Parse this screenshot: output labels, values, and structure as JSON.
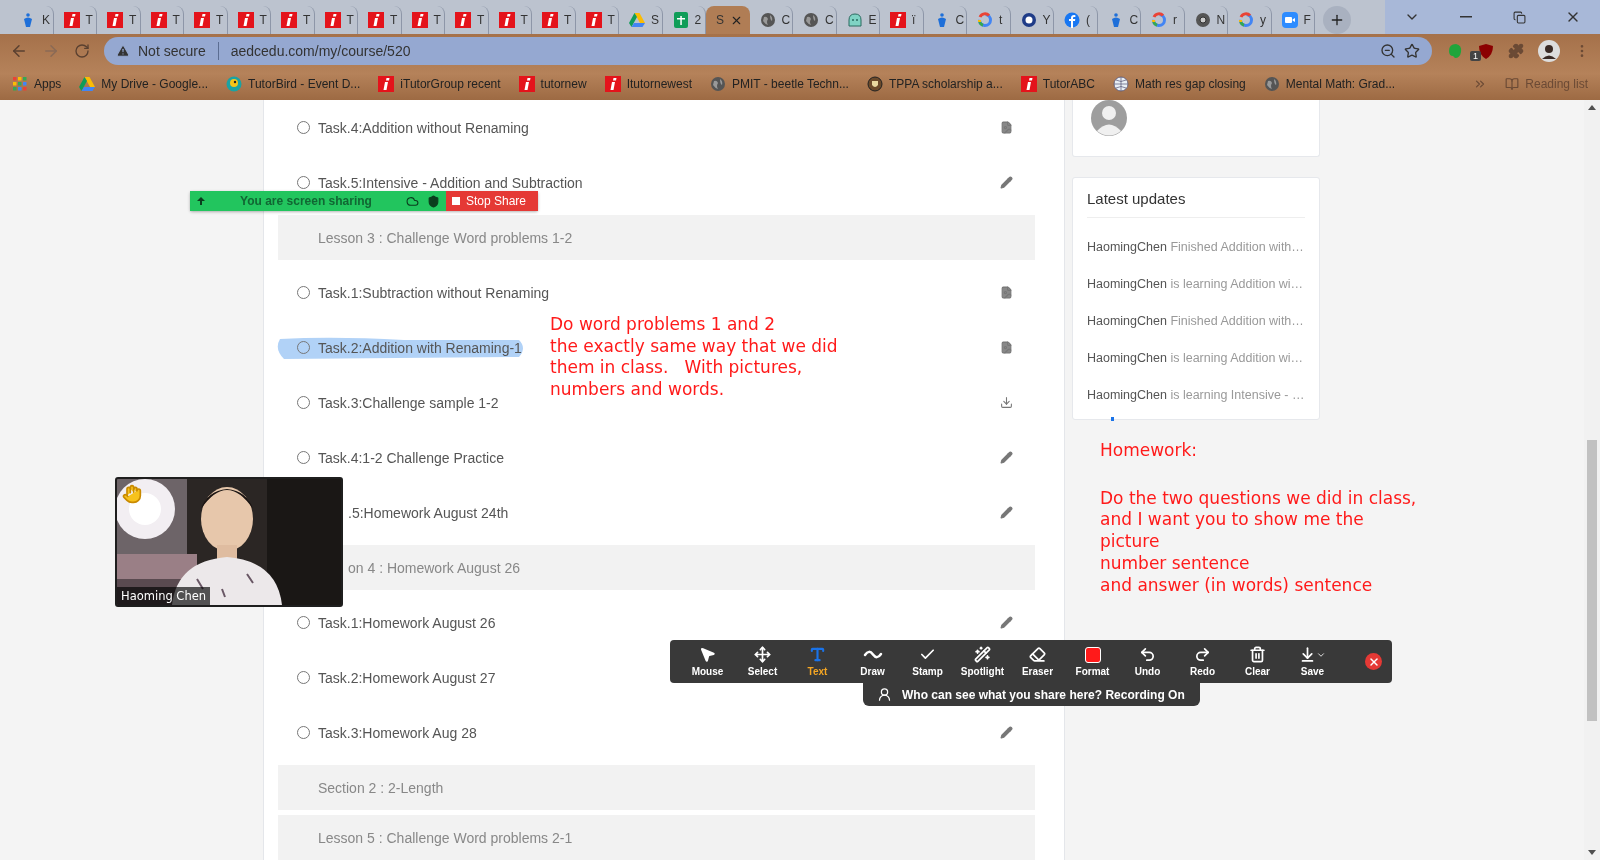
{
  "browser": {
    "tabs": [
      {
        "kind": "itutor",
        "title": "K",
        "selected": false
      },
      {
        "kind": "red-i",
        "title": "T",
        "selected": false
      },
      {
        "kind": "red-i",
        "title": "T",
        "selected": false
      },
      {
        "kind": "red-i",
        "title": "T",
        "selected": false
      },
      {
        "kind": "red-i",
        "title": "T",
        "selected": false
      },
      {
        "kind": "red-i",
        "title": "T",
        "selected": false
      },
      {
        "kind": "red-i",
        "title": "T",
        "selected": false
      },
      {
        "kind": "red-i",
        "title": "T",
        "selected": false
      },
      {
        "kind": "red-i",
        "title": "T",
        "selected": false
      },
      {
        "kind": "red-i",
        "title": "T",
        "selected": false
      },
      {
        "kind": "red-i",
        "title": "T",
        "selected": false
      },
      {
        "kind": "red-i",
        "title": "T",
        "selected": false
      },
      {
        "kind": "red-i",
        "title": "T",
        "selected": false
      },
      {
        "kind": "red-i",
        "title": "T",
        "selected": false
      },
      {
        "kind": "drive",
        "title": "S",
        "selected": false
      },
      {
        "kind": "sheets",
        "title": "2",
        "selected": false
      },
      {
        "kind": "none",
        "title": "S",
        "selected": true
      },
      {
        "kind": "globe",
        "title": "C",
        "selected": false
      },
      {
        "kind": "globe",
        "title": "C",
        "selected": false
      },
      {
        "kind": "bot",
        "title": "E",
        "selected": false
      },
      {
        "kind": "red-i",
        "title": "ï",
        "selected": false
      },
      {
        "kind": "itutor",
        "title": "C",
        "selected": false
      },
      {
        "kind": "google",
        "title": "t",
        "selected": false
      },
      {
        "kind": "gsite",
        "title": "Y",
        "selected": false
      },
      {
        "kind": "facebook",
        "title": "(",
        "selected": false
      },
      {
        "kind": "itutor",
        "title": "C",
        "selected": false
      },
      {
        "kind": "google",
        "title": "r",
        "selected": false
      },
      {
        "kind": "chrome",
        "title": "N",
        "selected": false
      },
      {
        "kind": "google",
        "title": "y",
        "selected": false
      },
      {
        "kind": "zoom",
        "title": "F",
        "selected": false
      }
    ],
    "address": {
      "security": "Not secure",
      "url": "aedcedu.com/my/course/520"
    },
    "extension_badge": "1",
    "bookmarks": [
      {
        "kind": "apps",
        "label": "Apps"
      },
      {
        "kind": "drive",
        "label": "My Drive - Google..."
      },
      {
        "kind": "bird",
        "label": "TutorBird - Event D..."
      },
      {
        "kind": "red-i",
        "label": "iTutorGroup recent"
      },
      {
        "kind": "red-i",
        "label": "tutornew"
      },
      {
        "kind": "red-i",
        "label": "Itutornewest"
      },
      {
        "kind": "globe",
        "label": "PMIT - beetle Techn..."
      },
      {
        "kind": "crest",
        "label": "TPPA scholarship a..."
      },
      {
        "kind": "red-i",
        "label": "TutorABC"
      },
      {
        "kind": "atlas",
        "label": "Math res gap closing"
      },
      {
        "kind": "globe",
        "label": "Mental Math: Grad..."
      }
    ],
    "reading_list": "Reading list"
  },
  "course": {
    "rows": [
      {
        "kind": "task",
        "label": "Task.4:Addition without Renaming",
        "icon": {
          "kind": "doc"
        },
        "covered": false,
        "highlighted": false
      },
      {
        "kind": "task",
        "label": "Task.5:Intensive - Addition and Subtraction",
        "icon": {
          "kind": "pencil"
        },
        "covered": false,
        "highlighted": false
      },
      {
        "kind": "header",
        "label": "Lesson 3 : Challenge Word problems 1-2",
        "covered": false
      },
      {
        "kind": "task",
        "label": "Task.1:Subtraction without Renaming",
        "icon": {
          "kind": "doc"
        },
        "covered": false,
        "highlighted": false
      },
      {
        "kind": "task",
        "label": "Task.2:Addition with Renaming-1",
        "icon": {
          "kind": "doc"
        },
        "covered": false,
        "highlighted": true
      },
      {
        "kind": "task",
        "label": "Task.3:Challenge sample 1-2",
        "icon": {
          "kind": "download"
        },
        "covered": false,
        "highlighted": false
      },
      {
        "kind": "task",
        "label": "Task.4:1-2 Challenge Practice",
        "icon": {
          "kind": "pencil"
        },
        "covered": false,
        "highlighted": false
      },
      {
        "kind": "task",
        "label": ".5:Homework August 24th",
        "icon": {
          "kind": "pencil"
        },
        "covered": true,
        "highlighted": false
      },
      {
        "kind": "header",
        "label": "on 4 : Homework August 26",
        "covered": true
      },
      {
        "kind": "task",
        "label": "Task.1:Homework August 26",
        "icon": {
          "kind": "pencil"
        },
        "covered": false,
        "highlighted": false
      },
      {
        "kind": "task",
        "label": "Task.2:Homework August 27",
        "covered": false,
        "highlighted": false
      },
      {
        "kind": "task",
        "label": "Task.3:Homework Aug 28",
        "icon": {
          "kind": "pencil"
        },
        "covered": false,
        "highlighted": false
      },
      {
        "kind": "header",
        "label": "Section 2 : 2-Length",
        "covered": false
      },
      {
        "kind": "header",
        "label": "Lesson 5 : Challenge Word problems 2-1",
        "covered": false
      }
    ]
  },
  "updates": {
    "title": "Latest updates",
    "items": [
      {
        "user": "HaomingChen",
        "action": "Finished Addition with…"
      },
      {
        "user": "HaomingChen",
        "action": "is learning Addition wi…"
      },
      {
        "user": "HaomingChen",
        "action": "Finished Addition with…"
      },
      {
        "user": "HaomingChen",
        "action": "is learning Addition wi…"
      },
      {
        "user": "HaomingChen",
        "action": "is learning Intensive - …"
      }
    ]
  },
  "annotations": {
    "note": [
      "Do word problems 1 and 2",
      "the exactly same way that we did",
      "them in class.   With pictures,",
      "numbers and words."
    ],
    "homework_title": "Homework:",
    "homework": [
      "Do the two questions we did in class,",
      "and I want you to show me the",
      "picture",
      "number sentence",
      "and answer (in words) sentence"
    ]
  },
  "share_bar": {
    "status": "You are screen sharing",
    "stop": "Stop Share"
  },
  "video": {
    "name": "Haoming Chen",
    "hand_raised": true
  },
  "annotation_toolbar": {
    "tools": [
      {
        "kind": "mouse",
        "label": "Mouse",
        "selected": false
      },
      {
        "kind": "select",
        "label": "Select",
        "selected": false
      },
      {
        "kind": "text",
        "label": "Text",
        "selected": true
      },
      {
        "kind": "draw",
        "label": "Draw",
        "selected": false
      },
      {
        "kind": "stamp",
        "label": "Stamp",
        "selected": false
      },
      {
        "kind": "spotlight",
        "label": "Spotlight",
        "selected": false
      },
      {
        "kind": "eraser",
        "label": "Eraser",
        "selected": false
      },
      {
        "kind": "format",
        "label": "Format",
        "selected": false
      },
      {
        "kind": "undo",
        "label": "Undo",
        "selected": false
      },
      {
        "kind": "redo",
        "label": "Redo",
        "selected": false
      },
      {
        "kind": "clear",
        "label": "Clear",
        "selected": false
      },
      {
        "kind": "save",
        "label": "Save",
        "selected": false
      }
    ],
    "notice": "Who can see what you share here? Recording On"
  }
}
